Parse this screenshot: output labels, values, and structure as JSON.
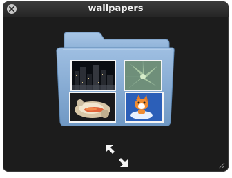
{
  "window": {
    "title": "wallpapers"
  },
  "folder": {
    "thumbnails": [
      {
        "name": "night-city-skyline"
      },
      {
        "name": "green-succulent-plant"
      },
      {
        "name": "flower-burst"
      },
      {
        "name": "fox-mascot"
      }
    ]
  },
  "controls": {
    "close_icon": "close-icon",
    "expand_icon": "fullscreen-expand-icon",
    "resize_icon": "resize-grip-icon"
  },
  "colors": {
    "window_bg": "#1c1c1c",
    "folder_blue": "#8fb3d8",
    "title_text": "#f2f2f2"
  }
}
